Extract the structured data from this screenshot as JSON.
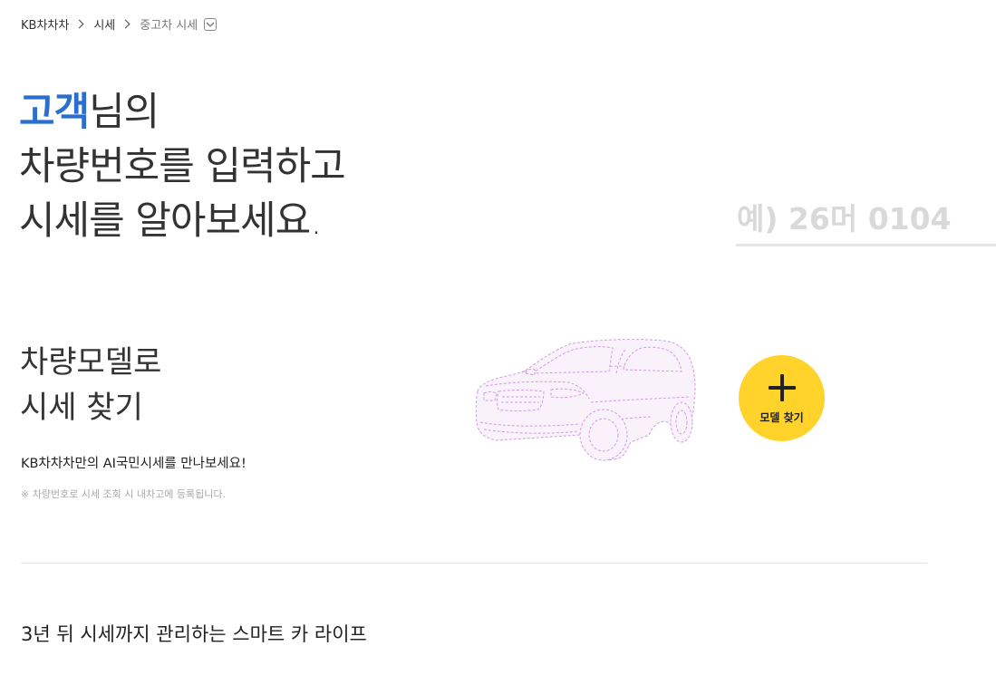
{
  "breadcrumb": {
    "home": "KB차차차",
    "level1": "시세",
    "current": "중고차 시세",
    "dropdown_icon": "chevron-down-icon"
  },
  "hero": {
    "line1_accent": "고객",
    "line1_rest": "님의",
    "line2": "차량번호를 입력하고",
    "line3": "시세를 알아보세요."
  },
  "plate_search": {
    "placeholder": "예) 26머 0104",
    "value": ""
  },
  "model_search": {
    "title_line1": "차량모델로",
    "title_line2": "시세 찾기",
    "promo": "KB차차차만의 AI국민시세를 만나보세요!",
    "note": "※ 차량번호로 시세 조회 시 내차고에 등록됩니다.",
    "button_label": "모델 찾기",
    "button_icon": "plus-icon",
    "car_icon": "car-outline-icon"
  },
  "smart_life": {
    "title": "3년 뒤 시세까지 관리하는 스마트 카 라이프"
  },
  "colors": {
    "accent_blue": "#2a6fd0",
    "button_yellow": "#ffd32a",
    "car_outline": "#d39be6",
    "car_fill": "#faf2fb"
  }
}
